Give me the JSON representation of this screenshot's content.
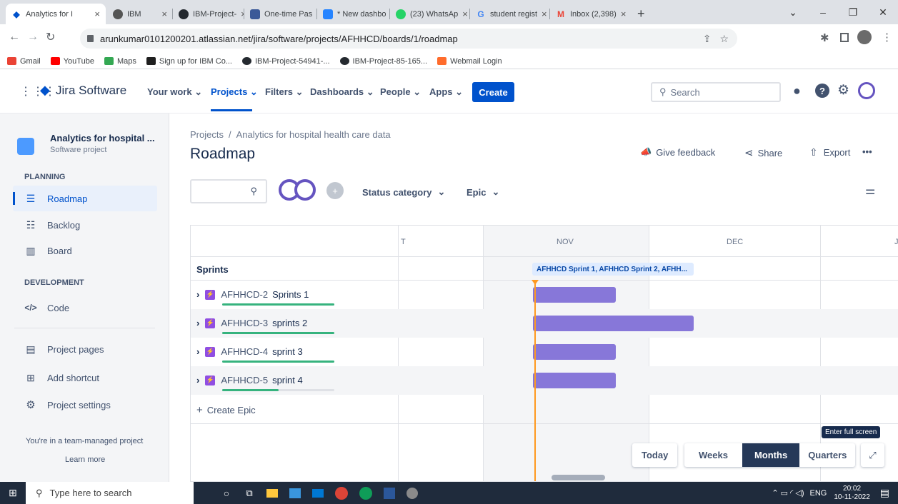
{
  "browser": {
    "tabs": [
      {
        "title": "Analytics for I",
        "color": "#0052cc"
      },
      {
        "title": "IBM",
        "color": "#555555"
      },
      {
        "title": "IBM-Project-",
        "color": "#24292f"
      },
      {
        "title": "One-time Pas",
        "color": "#3b5998"
      },
      {
        "title": "* New dashbo",
        "color": "#2684ff"
      },
      {
        "title": "(23) WhatsAp",
        "color": "#25d366"
      },
      {
        "title": "student regist",
        "color": "#4285f4"
      },
      {
        "title": "Inbox (2,398)",
        "color": "#ea4335"
      }
    ],
    "new_tab": "+",
    "url": "arunkumar0101200201.atlassian.net/jira/software/projects/AFHHCD/boards/1/roadmap",
    "bookmarks": [
      {
        "label": "Gmail",
        "color": "#ea4335"
      },
      {
        "label": "YouTube",
        "color": "#ff0000"
      },
      {
        "label": "Maps",
        "color": "#34a853"
      },
      {
        "label": "Sign up for IBM Co...",
        "color": "#1f1f1f"
      },
      {
        "label": "IBM-Project-54941-...",
        "color": "#24292f"
      },
      {
        "label": "IBM-Project-85-165...",
        "color": "#24292f"
      },
      {
        "label": "Webmail Login",
        "color": "#ff6c2c"
      }
    ]
  },
  "jira": {
    "product": "Jira Software",
    "nav": [
      "Your work",
      "Projects",
      "Filters",
      "Dashboards",
      "People",
      "Apps"
    ],
    "create": "Create",
    "search_placeholder": "Search"
  },
  "sidebar": {
    "project_name": "Analytics for hospital ...",
    "project_type": "Software project",
    "planning_label": "PLANNING",
    "planning_items": [
      "Roadmap",
      "Backlog",
      "Board"
    ],
    "development_label": "DEVELOPMENT",
    "dev_items": [
      "Code"
    ],
    "other_items": [
      "Project pages",
      "Add shortcut",
      "Project settings"
    ],
    "footer_text": "You're in a team-managed project",
    "learn_more": "Learn more"
  },
  "main": {
    "breadcrumb_root": "Projects",
    "breadcrumb_sep": "/",
    "breadcrumb_project": "Analytics for hospital health care data",
    "title": "Roadmap",
    "give_feedback": "Give feedback",
    "share": "Share",
    "export": "Export",
    "more": "•••",
    "status_filter": "Status category",
    "epic_filter": "Epic",
    "months": [
      "T",
      "NOV",
      "DEC",
      "JA"
    ],
    "sprints_header": "Sprints",
    "sprint_label": "AFHHCD Sprint 1, AFHHCD Sprint 2, AFHH...",
    "epics": [
      {
        "key": "AFHHCD-2",
        "name": "Sprints 1",
        "progress": 1.0
      },
      {
        "key": "AFHHCD-3",
        "name": "sprints 2",
        "progress": 1.0
      },
      {
        "key": "AFHHCD-4",
        "name": "sprint 3",
        "progress": 1.0
      },
      {
        "key": "AFHHCD-5",
        "name": "sprint 4",
        "progress": 0.5
      }
    ],
    "create_epic": "Create Epic",
    "tooltip": "Enter full screen",
    "view_buttons": [
      "Today",
      "Weeks",
      "Months",
      "Quarters"
    ],
    "active_view": "Months"
  },
  "taskbar": {
    "search_placeholder": "Type here to search",
    "lang": "ENG",
    "time": "20:02",
    "date": "10-11-2022"
  }
}
